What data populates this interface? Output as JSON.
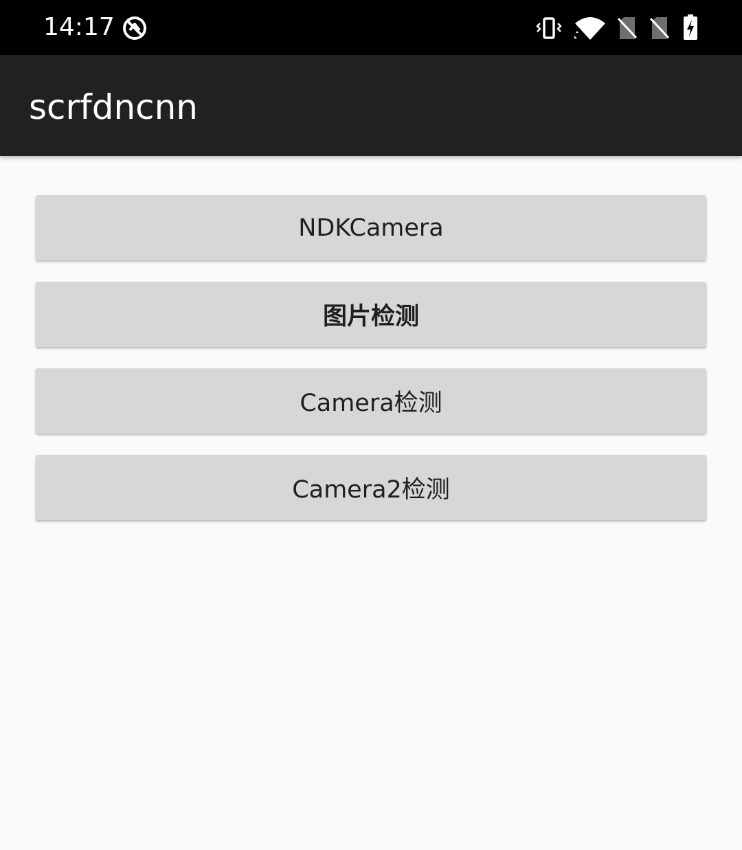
{
  "status_bar": {
    "time": "14:17",
    "icons": [
      "do-not-disturb-icon",
      "vibrate-icon",
      "wifi-icon",
      "no-sim-icon",
      "no-sim-icon",
      "battery-charging-icon"
    ]
  },
  "app_bar": {
    "title": "scrfdncnn",
    "background": "#212121"
  },
  "buttons": [
    {
      "label": "NDKCamera"
    },
    {
      "label": "图片检测"
    },
    {
      "label": "Camera检测"
    },
    {
      "label": "Camera2检测"
    }
  ],
  "colors": {
    "status_bar": "#000000",
    "content_background": "#fafafa",
    "button_background": "#d6d7d7",
    "button_text": "#1f1f1f"
  }
}
